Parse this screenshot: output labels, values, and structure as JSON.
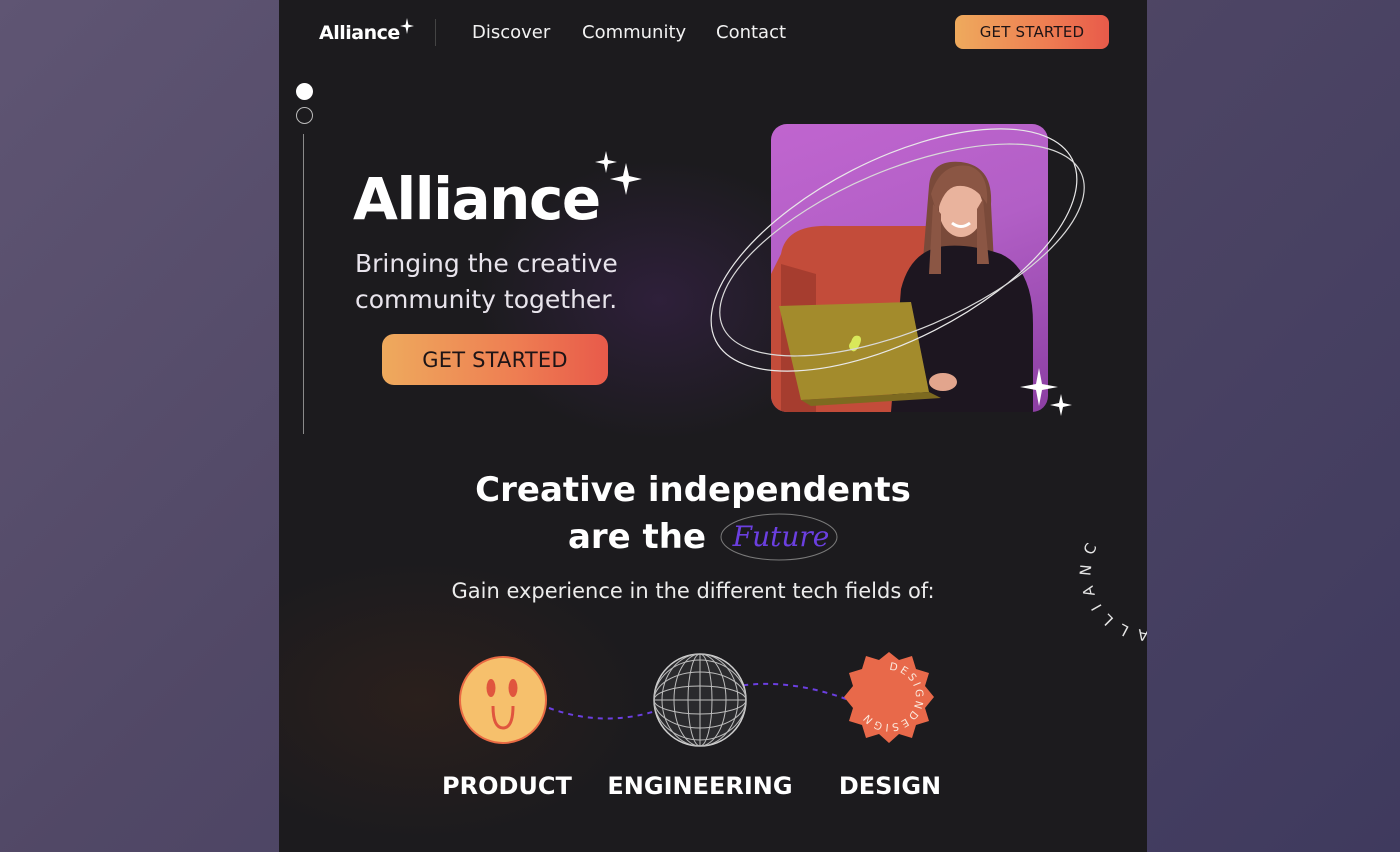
{
  "nav": {
    "logo": "Alliance",
    "links": [
      "Discover",
      "Community",
      "Contact"
    ],
    "cta": "GET STARTED"
  },
  "hero": {
    "title": "Alliance",
    "subtitle_line1": "Bringing the creative",
    "subtitle_line2": "community together.",
    "cta": "GET STARTED"
  },
  "section": {
    "title_line1": "Creative independents",
    "title_line2": "are the",
    "title_script": "Future",
    "subtitle": "Gain experience in the different tech fields of:"
  },
  "fields": [
    {
      "label": "PRODUCT",
      "icon": "smiley-icon"
    },
    {
      "label": "ENGINEERING",
      "icon": "disco-ball-icon"
    },
    {
      "label": "DESIGN",
      "icon": "design-badge-icon",
      "badge_text": "DESIGNDESIGN"
    }
  ],
  "side_text": "ALLIANC",
  "colors": {
    "background": "#1c1b1e",
    "accent_start": "#eeaa5d",
    "accent_end": "#e85a4a",
    "script_purple": "#6b3fe0"
  }
}
